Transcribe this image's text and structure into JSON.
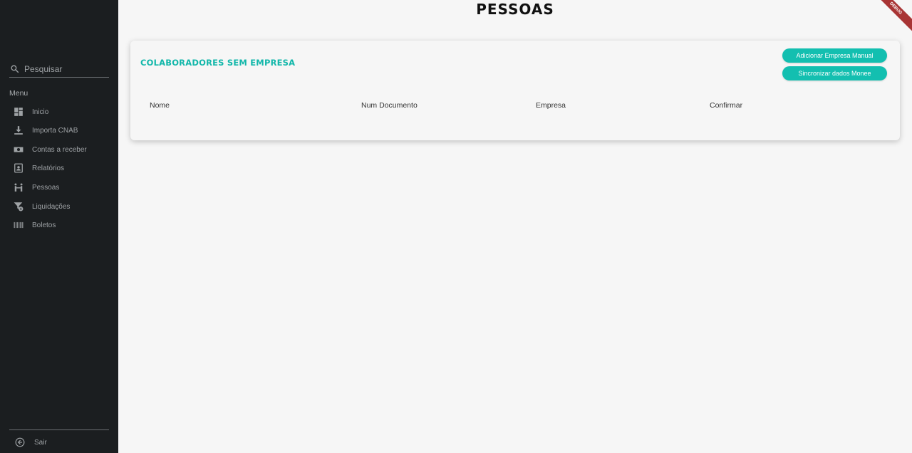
{
  "page": {
    "title": "PESSOAS",
    "debug_banner": "DEBUG"
  },
  "sidebar": {
    "search": {
      "placeholder": "Pesquisar"
    },
    "menu_label": "Menu",
    "items": [
      {
        "label": "Inicio",
        "icon": "dashboard-icon"
      },
      {
        "label": "Importa CNAB",
        "icon": "download-icon"
      },
      {
        "label": "Contas a receber",
        "icon": "cash-icon"
      },
      {
        "label": "Relatórios",
        "icon": "contact-book-icon"
      },
      {
        "label": "Pessoas",
        "icon": "people-icon"
      },
      {
        "label": "Liquidações",
        "icon": "filter-money-icon"
      },
      {
        "label": "Boletos",
        "icon": "barcode-icon"
      }
    ],
    "logout": {
      "label": "Sair",
      "icon": "exit-icon"
    }
  },
  "card": {
    "title": "COLABORADORES SEM EMPRESA",
    "buttons": {
      "add_manual": "Adicionar Empresa Manual",
      "sync": "Sincronizar dados Monee"
    },
    "columns": [
      "Nome",
      "Num Documento",
      "Empresa",
      "Confirmar"
    ]
  },
  "colors": {
    "sidebar_bg": "#1b1e20",
    "accent": "#13bfb0",
    "page_bg": "#f6f6f6"
  }
}
